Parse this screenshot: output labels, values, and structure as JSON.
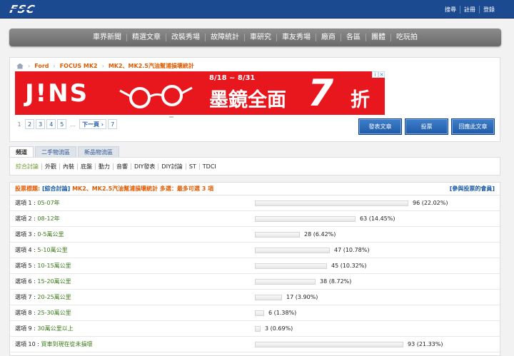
{
  "header": {
    "logo": "FSC",
    "links": [
      "搜尋",
      "註冊",
      "登錄"
    ]
  },
  "nav": [
    "車界新聞",
    "精選文章",
    "改裝秀場",
    "故障統計",
    "車研究",
    "車友秀場",
    "廠商",
    "各區",
    "團體",
    "吃玩拍"
  ],
  "breadcrumb": [
    "Ford",
    "FOCUS MK2",
    "MK2、MK2.5汽油幫浦損壞統計"
  ],
  "ad": {
    "brand": "J!NS",
    "date": "8/18 ~ 8/31",
    "headline": "墨鏡全面",
    "number": "7",
    "suffix": "折"
  },
  "pager": {
    "pages": [
      "1",
      "2",
      "3",
      "4",
      "5",
      "...",
      "下一頁 ›",
      "7"
    ]
  },
  "actions": [
    "發表文章",
    "投票",
    "回應此文章"
  ],
  "tabs": [
    "頻道",
    "二手物流區",
    "新品物流區"
  ],
  "subtabs": [
    "綜合討論",
    "外觀",
    "內裝",
    "底盤",
    "動力",
    "音響",
    "DIY發表",
    "DIY討論",
    "ST",
    "TDCI"
  ],
  "poll": {
    "title_prefix": "投票標題: ",
    "category": "[綜合討論]",
    "title": " MK2、MK2.5汽油幫浦損壞統計  多選：最多可選 3 項",
    "members_link": "[參與投票的會員]",
    "options": [
      {
        "prefix": "選項 1 : ",
        "label": "05-07年",
        "votes": 96,
        "pct": "22.02%",
        "fraction": 0.2202
      },
      {
        "prefix": "選項 2 : ",
        "label": "08-12年",
        "votes": 63,
        "pct": "14.45%",
        "fraction": 0.1445
      },
      {
        "prefix": "選項 3 : ",
        "label": "0-5萬公里",
        "votes": 28,
        "pct": "6.42%",
        "fraction": 0.0642
      },
      {
        "prefix": "選項 4 : ",
        "label": "5-10萬公里",
        "votes": 47,
        "pct": "10.78%",
        "fraction": 0.1078
      },
      {
        "prefix": "選項 5 : ",
        "label": "10-15萬公里",
        "votes": 45,
        "pct": "10.32%",
        "fraction": 0.1032
      },
      {
        "prefix": "選項 6 : ",
        "label": "15-20萬公里",
        "votes": 38,
        "pct": "8.72%",
        "fraction": 0.0872
      },
      {
        "prefix": "選項 7 : ",
        "label": "20-25萬公里",
        "votes": 17,
        "pct": "3.90%",
        "fraction": 0.039
      },
      {
        "prefix": "選項 8 : ",
        "label": "25-30萬公里",
        "votes": 6,
        "pct": "1.38%",
        "fraction": 0.0138
      },
      {
        "prefix": "選項 9 : ",
        "label": "30萬公里以上",
        "votes": 3,
        "pct": "0.69%",
        "fraction": 0.0069
      },
      {
        "prefix": "選項 10 : ",
        "label": "買車到現在從未損壞",
        "votes": 93,
        "pct": "21.33%",
        "fraction": 0.2133
      }
    ]
  }
}
